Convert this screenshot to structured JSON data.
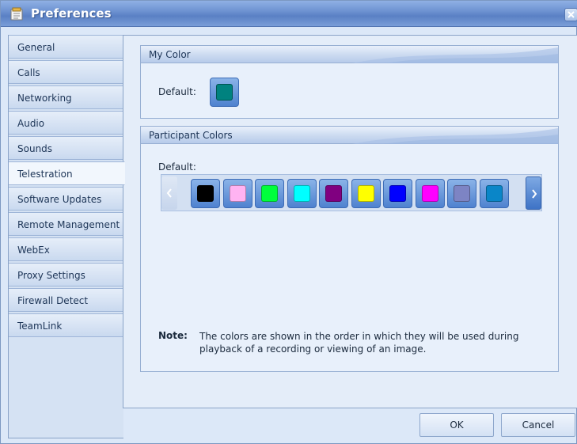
{
  "window": {
    "title": "Preferences"
  },
  "sidebar": {
    "items": [
      {
        "label": "General"
      },
      {
        "label": "Calls"
      },
      {
        "label": "Networking"
      },
      {
        "label": "Audio"
      },
      {
        "label": "Sounds"
      },
      {
        "label": "Telestration",
        "active": true
      },
      {
        "label": "Software Updates"
      },
      {
        "label": "Remote Management"
      },
      {
        "label": "WebEx"
      },
      {
        "label": "Proxy Settings"
      },
      {
        "label": "Firewall Detect"
      },
      {
        "label": "TeamLink"
      }
    ]
  },
  "my_color": {
    "header": "My Color",
    "default_label": "Default:",
    "color": "#00827f"
  },
  "participant_colors": {
    "header": "Participant Colors",
    "default_label": "Default:",
    "colors": [
      "#000000",
      "#ffb3f2",
      "#00ff3c",
      "#00ffff",
      "#800080",
      "#ffff00",
      "#0000ff",
      "#ff00ff",
      "#7d84c4",
      "#0a86c8"
    ]
  },
  "note": {
    "label": "Note:",
    "text": "The colors are shown in the order in which they will be used during playback of a recording or viewing of an image."
  },
  "buttons": {
    "ok": "OK",
    "cancel": "Cancel"
  },
  "colors": {
    "accent": "#4f82cf",
    "titlebar": "#6e93d2"
  }
}
